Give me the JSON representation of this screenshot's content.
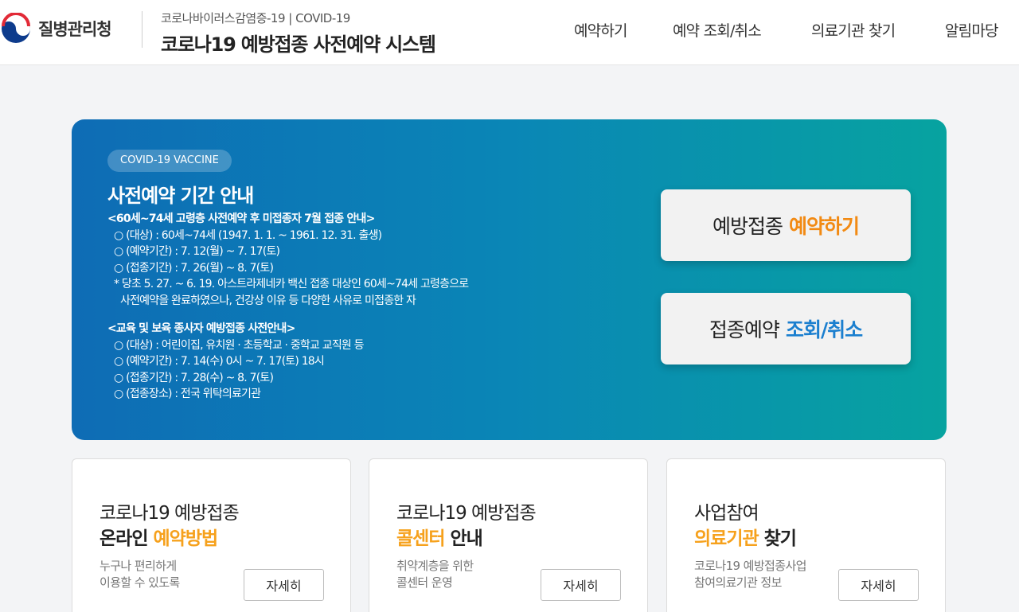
{
  "header": {
    "agency_name": "질병관리청",
    "site_subtitle": "코로나바이러스감염증-19 | COVID-19",
    "site_title": "코로나19 예방접종 사전예약 시스템",
    "nav": [
      "예약하기",
      "예약 조회/취소",
      "의료기관 찾기",
      "알림마당"
    ]
  },
  "hero": {
    "badge": "COVID-19 VACCINE",
    "title": "사전예약 기간 안내",
    "notice1": {
      "heading": "<60세~74세 고령층 사전예약 후 미접종자 7월 접종 안내>",
      "lines": [
        "○ (대상) : 60세~74세 (1947. 1. 1. ~ 1961. 12. 31. 출생)",
        "○ (예약기간) : 7. 12(월) ~ 7. 17(토)",
        "○ (접종기간) : 7. 26(월) ~ 8. 7(토)",
        "* 당초 5. 27. ~ 6. 19. 아스트라제네카 백신 접종 대상인 60세~74세 고령층으로",
        "  사전예약을 완료하였으나, 건강상 이유 등 다양한 사유로 미접종한 자"
      ]
    },
    "notice2": {
      "heading": "<교육 및 보육 종사자 예방접종 사전안내>",
      "lines": [
        "○ (대상) : 어린이집, 유치원 · 초등학교 · 중학교 교직원 등",
        "○ (예약기간) : 7. 14(수) 0시 ~ 7. 17(토) 18시",
        "○ (접종기간) : 7. 28(수) ~ 8. 7(토)",
        "○ (접종장소) : 전국 위탁의료기관"
      ]
    },
    "btn_reserve": {
      "prefix": "예방접종",
      "highlight": "예약하기"
    },
    "btn_lookup": {
      "prefix": "접종예약",
      "highlight": "조회/취소"
    }
  },
  "cards": [
    {
      "line1": "코로나19 예방접종",
      "line2_plain": "온라인 ",
      "line2_hl": "예약방법",
      "line2_tail": "",
      "desc1": "누구나 편리하게",
      "desc2": "이용할 수 있도록",
      "button": "자세히"
    },
    {
      "line1": "코로나19 예방접종",
      "line2_plain": "",
      "line2_hl": "콜센터",
      "line2_tail": " 안내",
      "desc1": "취약계층을 위한",
      "desc2": "콜센터 운영",
      "button": "자세히"
    },
    {
      "line1": "사업참여",
      "line2_plain": "",
      "line2_hl": "의료기관",
      "line2_tail": " 찾기",
      "desc1": "코로나19 예방접종사업",
      "desc2": "참여의료기관 정보",
      "button": "자세히"
    }
  ],
  "colors": {
    "accent_orange": "#f28a13",
    "accent_blue": "#1b7fcf",
    "card_highlight": "#f6a11c",
    "hero_start": "#0e6cb5",
    "hero_end": "#07a3a0"
  }
}
